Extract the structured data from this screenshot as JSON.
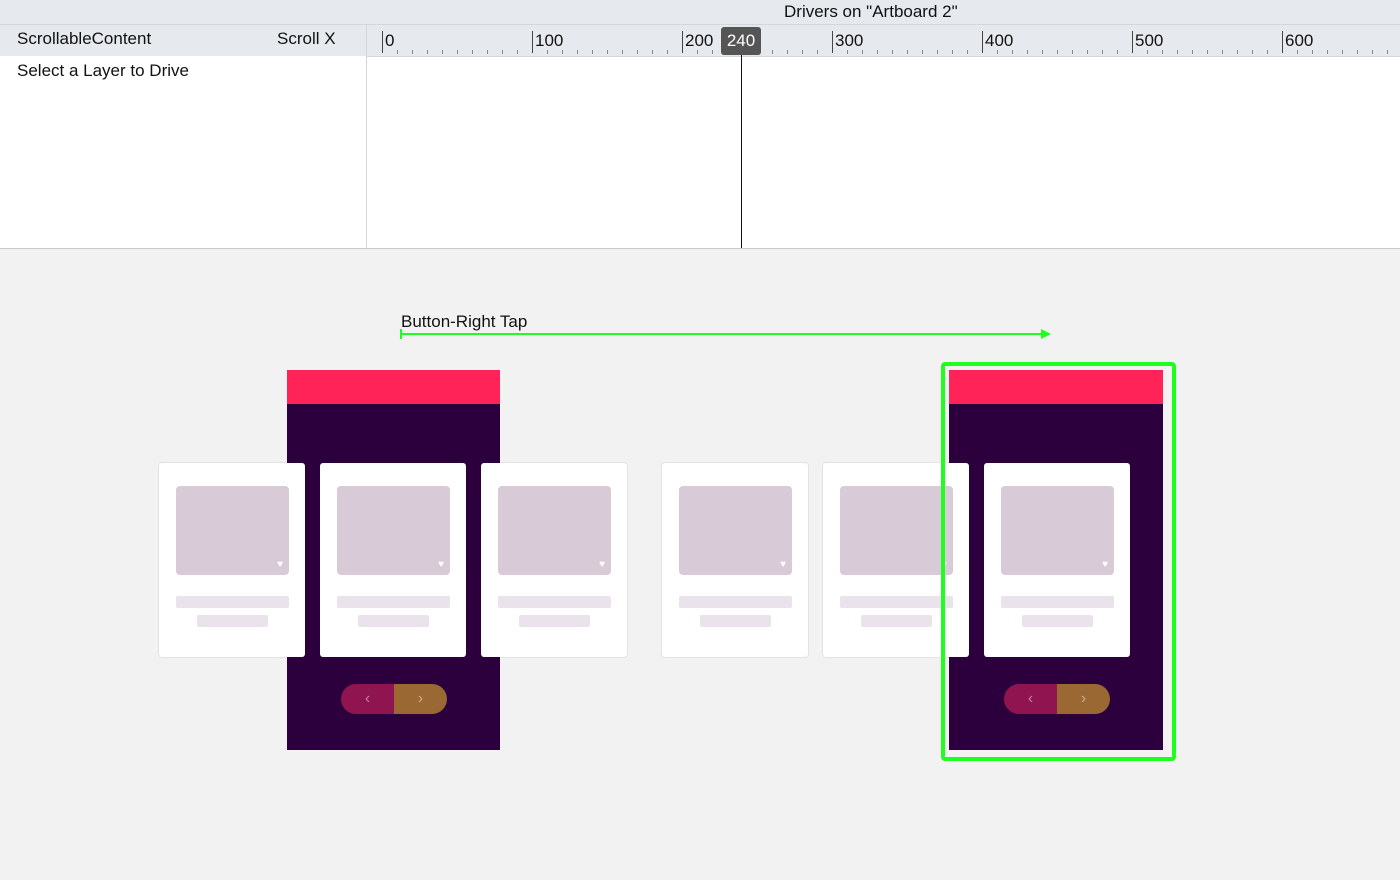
{
  "drivers_panel": {
    "title": "Drivers on \"Artboard 2\"",
    "layer_name": "ScrollableContent",
    "property_name": "Scroll X",
    "empty_hint": "Select a Layer to Drive",
    "ruler_labels": [
      "0",
      "100",
      "200",
      "300",
      "400",
      "500",
      "600"
    ],
    "playhead_value": "240"
  },
  "canvas": {
    "transition_label": "Button-Right Tap",
    "colors": {
      "header_pink": "#ff2358",
      "phone_purple": "#2c003d",
      "selection_green": "#1fff1f",
      "pill_left": "#8f1450",
      "pill_right": "#9a6832"
    },
    "pill": {
      "prev_glyph": "‹",
      "next_glyph": "›"
    },
    "card_icon": "heart-icon",
    "card_heart_glyph": "♥"
  }
}
